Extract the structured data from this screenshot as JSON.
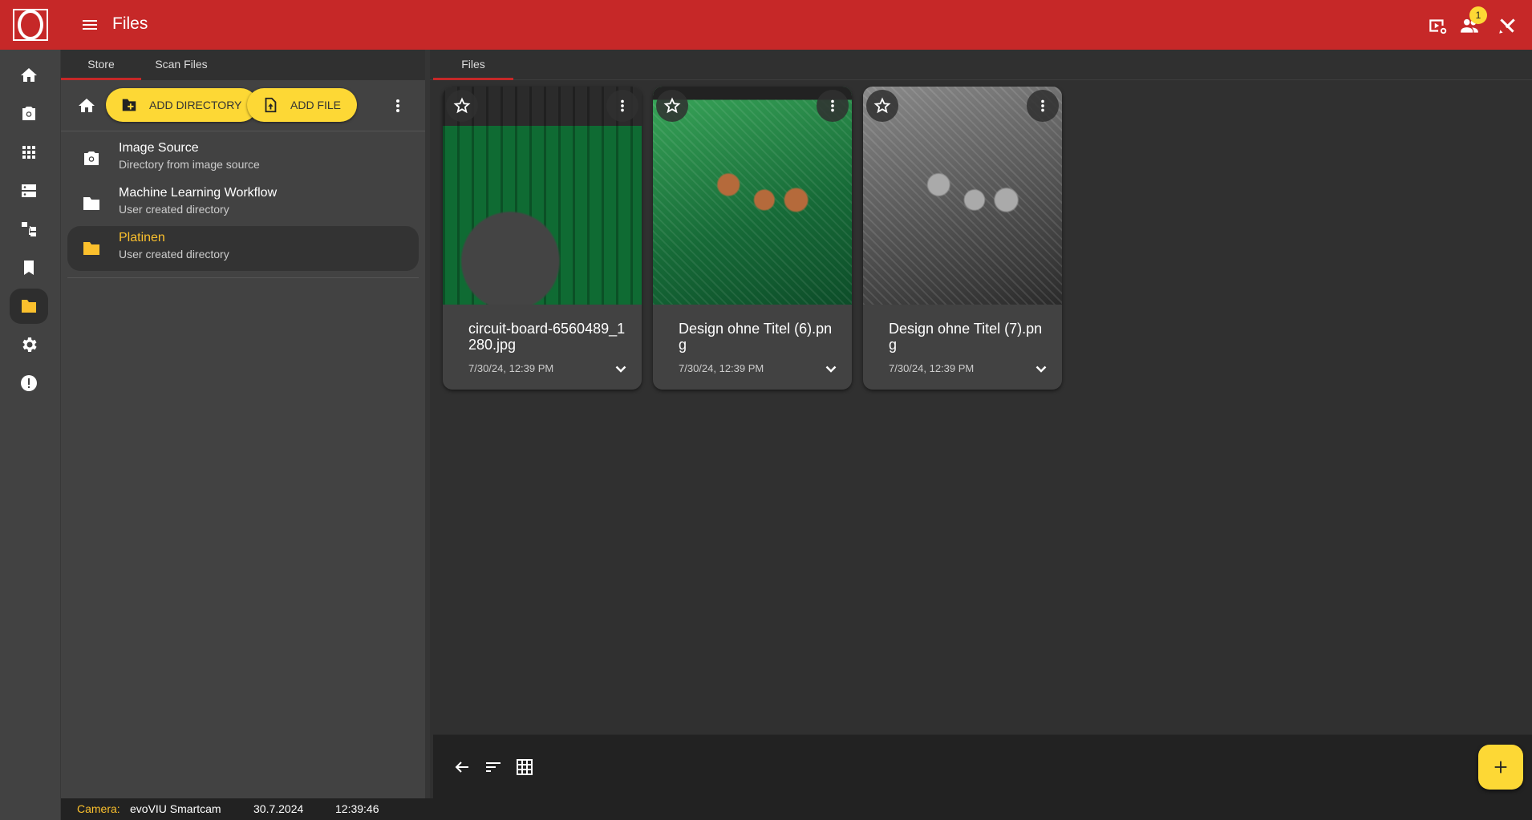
{
  "header": {
    "title": "Files",
    "notification_count": "1",
    "icons": [
      "logo-icon",
      "menu-icon",
      "video-settings-icon",
      "users-icon",
      "tools-icon"
    ]
  },
  "nav_rail": {
    "items": [
      {
        "name": "home",
        "icon": "home-icon",
        "active": false
      },
      {
        "name": "camera",
        "icon": "camera-icon",
        "active": false
      },
      {
        "name": "apps",
        "icon": "grid-icon",
        "active": false
      },
      {
        "name": "storage",
        "icon": "storage-icon",
        "active": false
      },
      {
        "name": "workflow",
        "icon": "workflow-icon",
        "active": false
      },
      {
        "name": "bookmarks",
        "icon": "bookmark-icon",
        "active": false
      },
      {
        "name": "files",
        "icon": "folder-icon",
        "active": true
      },
      {
        "name": "settings",
        "icon": "gear-icon",
        "active": false
      },
      {
        "name": "info",
        "icon": "alert-icon",
        "active": false
      }
    ]
  },
  "store_panel": {
    "tabs": [
      {
        "label": "Store",
        "active": true
      },
      {
        "label": "Scan Files",
        "active": false
      }
    ],
    "toolbar": {
      "add_directory_label": "ADD DIRECTORY",
      "add_file_label": "ADD FILE"
    },
    "directories": [
      {
        "title": "Image Source",
        "subtitle": "Directory from image source",
        "icon": "camera-icon",
        "active": false
      },
      {
        "title": "Machine Learning Workflow",
        "subtitle": "User created directory",
        "icon": "folder-icon",
        "active": false
      },
      {
        "title": "Platinen",
        "subtitle": "User created directory",
        "icon": "folder-icon",
        "active": true
      }
    ]
  },
  "main": {
    "tabs": [
      {
        "label": "Files",
        "active": true
      }
    ],
    "files": [
      {
        "name": "circuit-board-6560489_1280.jpg",
        "date": "7/30/24, 12:39 PM"
      },
      {
        "name": "Design ohne Titel (6).png",
        "date": "7/30/24, 12:39 PM"
      },
      {
        "name": "Design ohne Titel (7).png",
        "date": "7/30/24, 12:39 PM"
      }
    ]
  },
  "status_bar": {
    "camera_label": "Camera:",
    "camera_name": "evoVIU Smartcam",
    "date": "30.7.2024",
    "time": "12:39:46"
  },
  "colors": {
    "header": "#c62828",
    "accent": "#fdd835",
    "active_text": "#fbc02d",
    "panel": "#424242",
    "background": "#303030"
  }
}
